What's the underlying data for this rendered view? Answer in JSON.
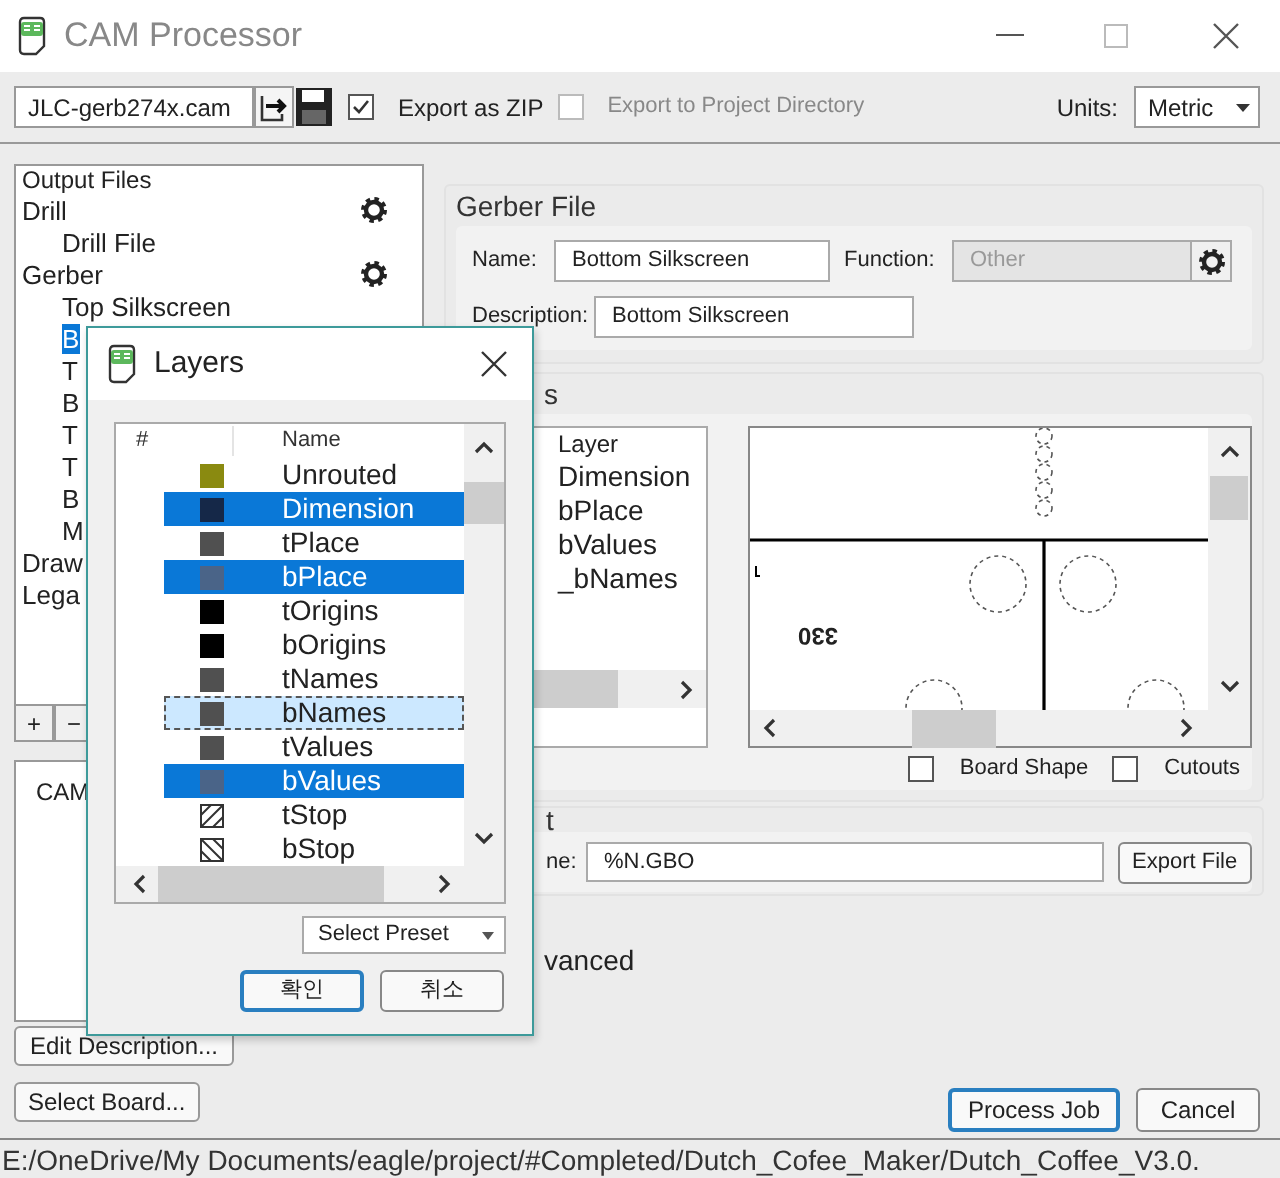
{
  "window": {
    "title": "CAM Processor"
  },
  "toolbar": {
    "job_file": "JLC-gerb274x.cam",
    "export_zip": {
      "label": "Export as ZIP",
      "checked": true,
      "disabled": false
    },
    "export_project_dir": {
      "label": "Export to Project Directory",
      "checked": false,
      "disabled": true
    },
    "units_label": "Units:",
    "units": "Metric"
  },
  "output_tree": {
    "header": "Output Files",
    "items": [
      {
        "label": "Drill",
        "gear": true,
        "selected": false,
        "children": [
          {
            "label": "Drill File",
            "selected": false
          }
        ]
      },
      {
        "label": "Gerber",
        "gear": true,
        "selected": false,
        "children": [
          {
            "label": "Top Silkscreen",
            "selected": false
          },
          {
            "label": "B",
            "selected": true
          },
          {
            "label": "T",
            "selected": false
          },
          {
            "label": "B",
            "selected": false
          },
          {
            "label": "T",
            "selected": false
          },
          {
            "label": "T",
            "selected": false
          },
          {
            "label": "B",
            "selected": false
          },
          {
            "label": "M",
            "selected": false
          }
        ]
      },
      {
        "label": "Draw",
        "gear": false,
        "selected": false
      },
      {
        "label": "Lega",
        "gear": false,
        "selected": false
      }
    ],
    "buttons": [
      "+",
      "−"
    ]
  },
  "cam_panel": {
    "text": "CAM"
  },
  "left_buttons": [
    "Edit Description...",
    "Select Board..."
  ],
  "gerber_file": {
    "title": "Gerber File",
    "name_label": "Name:",
    "name": "Bottom Silkscreen",
    "function_label": "Function:",
    "function": "Other",
    "function_disabled": true,
    "description_label": "Description:",
    "description": "Bottom Silkscreen"
  },
  "layers_section": {
    "title": "s",
    "list_header": "Layer",
    "layers": [
      "Dimension",
      "bPlace",
      "bValues",
      "_bNames"
    ],
    "preview_label": "330",
    "board_shape": {
      "label": "Board Shape",
      "checked": false
    },
    "cutouts": {
      "label": "Cutouts",
      "checked": false
    }
  },
  "output_section": {
    "title": "t",
    "file_label": "ne:",
    "file": "%N.GBO",
    "button": "Export File"
  },
  "advanced_label": "vanced",
  "bottom_buttons": [
    {
      "label": "Process Job",
      "default": true
    },
    {
      "label": "Cancel",
      "default": false
    }
  ],
  "status_bar": "E:/OneDrive/My Documents/eagle/project/#Completed/Dutch_Cofee_Maker/Dutch_Coffee_V3.0.",
  "layers_dialog": {
    "title": "Layers",
    "columns": [
      "#",
      "Name"
    ],
    "rows": [
      {
        "name": "Unrouted",
        "kind": "solid",
        "color": "#8a8a10",
        "selected": false,
        "focused": false
      },
      {
        "name": "Dimension",
        "kind": "solid",
        "color": "#152848",
        "selected": true,
        "focused": false
      },
      {
        "name": "tPlace",
        "kind": "solid",
        "color": "#505050",
        "selected": false,
        "focused": false
      },
      {
        "name": "bPlace",
        "kind": "solid",
        "color": "#4a6488",
        "selected": true,
        "focused": false
      },
      {
        "name": "tOrigins",
        "kind": "solid",
        "color": "#000000",
        "selected": false,
        "focused": false
      },
      {
        "name": "bOrigins",
        "kind": "solid",
        "color": "#000000",
        "selected": false,
        "focused": false
      },
      {
        "name": "tNames",
        "kind": "solid",
        "color": "#505050",
        "selected": false,
        "focused": false
      },
      {
        "name": "bNames",
        "kind": "solid",
        "color": "#505050",
        "selected": false,
        "focused": true
      },
      {
        "name": "tValues",
        "kind": "solid",
        "color": "#505050",
        "selected": false,
        "focused": false
      },
      {
        "name": "bValues",
        "kind": "solid",
        "color": "#4a6488",
        "selected": true,
        "focused": false
      },
      {
        "name": "tStop",
        "kind": "hatch_forward",
        "selected": false,
        "focused": false
      },
      {
        "name": "bStop",
        "kind": "hatch_back",
        "selected": false,
        "focused": false
      }
    ],
    "preset": "Select Preset",
    "buttons": [
      {
        "label": "확인",
        "default": true
      },
      {
        "label": "취소",
        "default": false
      }
    ]
  }
}
